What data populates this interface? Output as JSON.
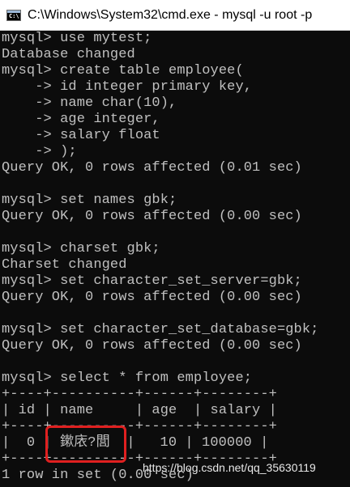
{
  "window": {
    "title": "C:\\Windows\\System32\\cmd.exe - mysql  -u root -p",
    "icon_label": "C:\\"
  },
  "console": {
    "lines": [
      "mysql> use mytest;",
      "Database changed",
      "mysql> create table employee(",
      "    -> id integer primary key,",
      "    -> name char(10),",
      "    -> age integer,",
      "    -> salary float",
      "    -> );",
      "Query OK, 0 rows affected (0.01 sec)",
      "",
      "mysql> set names gbk;",
      "Query OK, 0 rows affected (0.00 sec)",
      "",
      "mysql> charset gbk;",
      "Charset changed",
      "mysql> set character_set_server=gbk;",
      "Query OK, 0 rows affected (0.00 sec)",
      "",
      "mysql> set character_set_database=gbk;",
      "Query OK, 0 rows affected (0.00 sec)",
      "",
      "mysql> select * from employee;",
      "+----+----------+------+--------+",
      "| id | name     | age  | salary |",
      "+----+----------+------+--------+",
      "|  0 | 鏉庡?閭  |   10 | 100000 |",
      "+----+----------+------+--------+",
      "1 row in set (0.00 sec)"
    ]
  },
  "watermark": "https://blog.csdn.net/qq_35630119"
}
